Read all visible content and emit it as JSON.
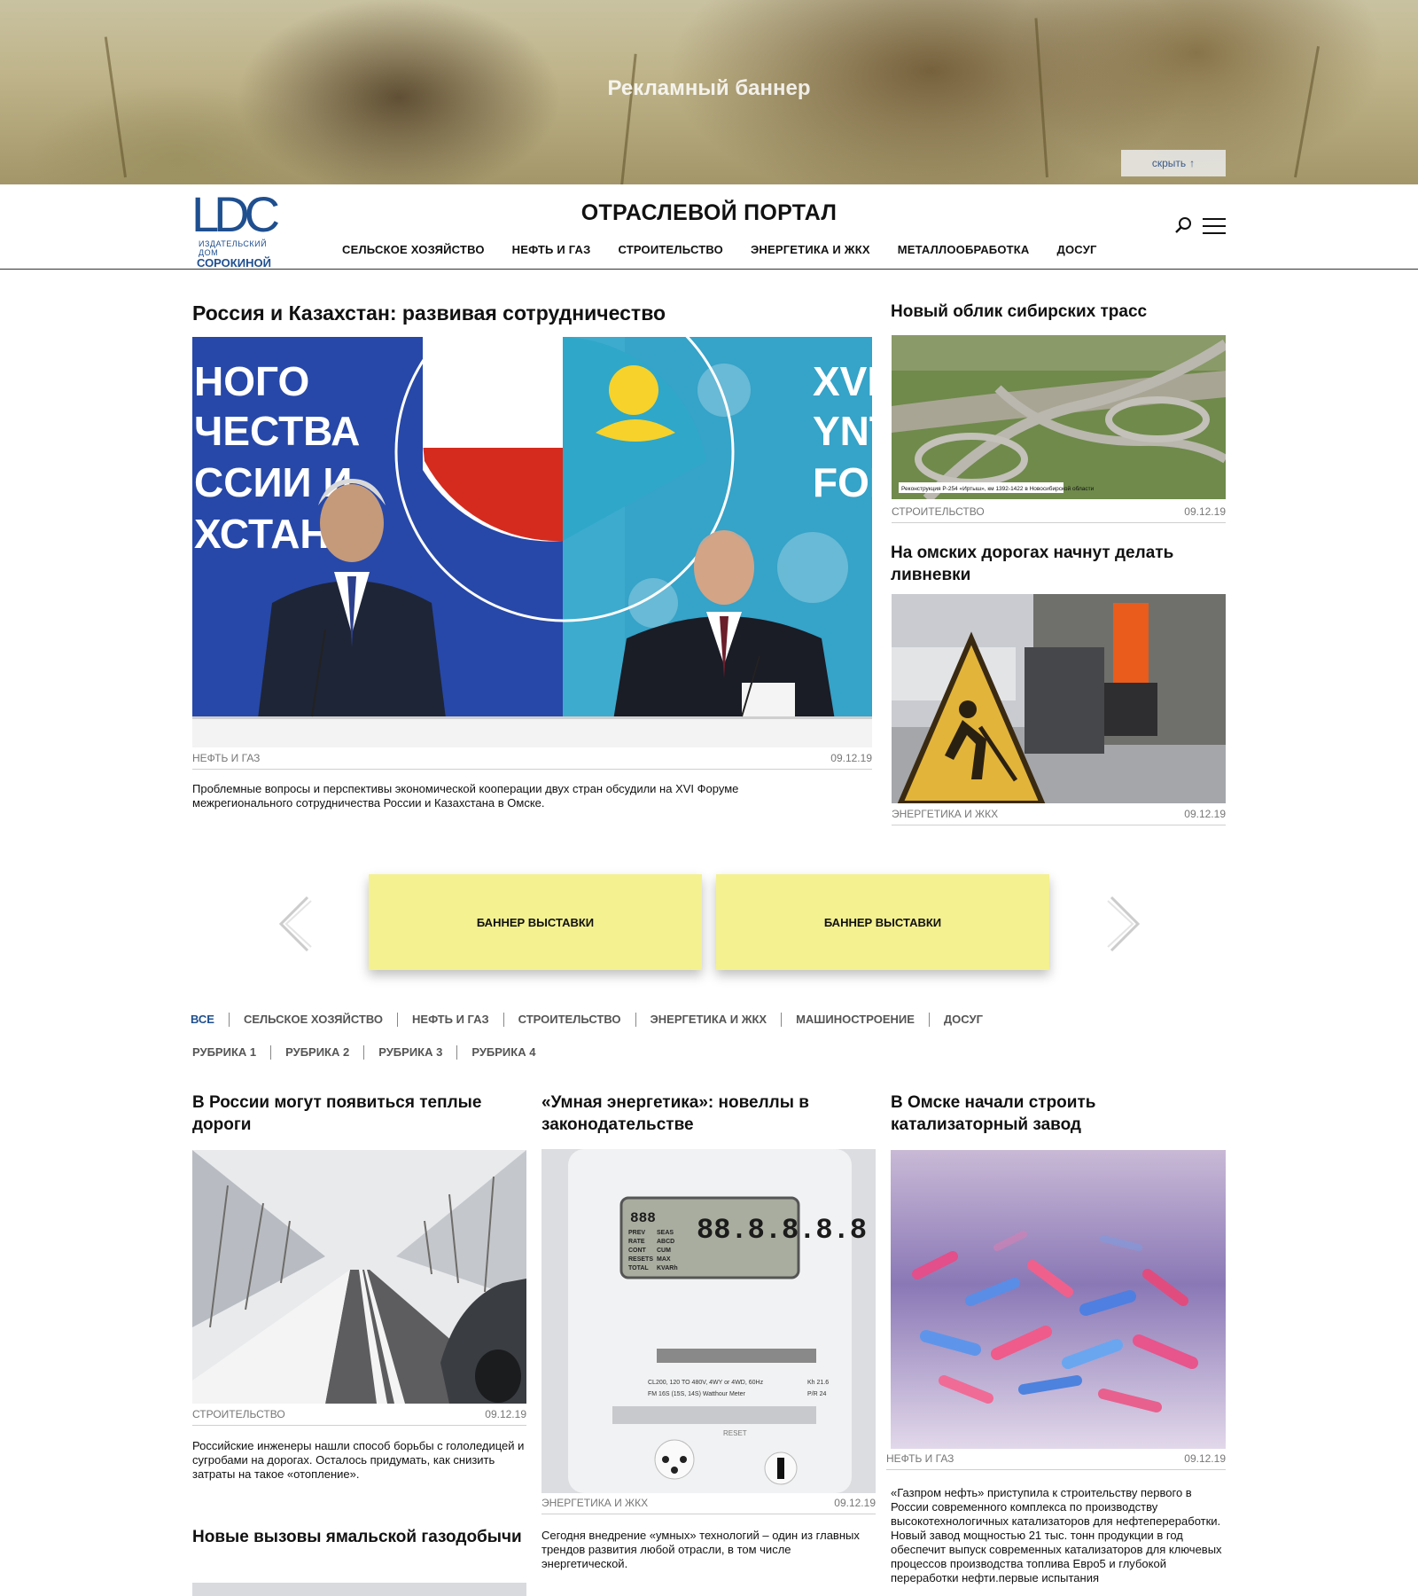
{
  "ad_banner": {
    "label": "Рекламный баннер",
    "hide_label": "скрыть",
    "hide_arrow": "↑"
  },
  "header": {
    "logo": {
      "mark": "LDC",
      "line1": "ИЗДАТЕЛЬСКИЙ ДОМ",
      "line2": "СОРОКИНОЙ"
    },
    "title": "ОТРАСЛЕВОЙ ПОРТАЛ",
    "nav": [
      "СЕЛЬСКОЕ ХОЗЯЙСТВО",
      "НЕФТЬ И ГАЗ",
      "СТРОИТЕЛЬСТВО",
      "ЭНЕРГЕТИКА И ЖКХ",
      "МЕТАЛЛООБРАБОТКА",
      "ДОСУГ"
    ]
  },
  "featured": {
    "title": "Россия и Казахстан: развивая сотрудничество",
    "category": "НЕФТЬ И ГАЗ",
    "date": "09.12.19",
    "lead": "Проблемные вопросы и перспективы экономической кооперации двух стран обсудили на XVI Форуме межрегионального сотрудничества России и Казахстана в Омске.",
    "backdrop_left": [
      "НОГО",
      "ЧЕСТВА",
      "ССИИ И",
      "ХСТАНА"
    ],
    "backdrop_right": [
      "XVI",
      "YNT",
      "FOR"
    ]
  },
  "side_articles": [
    {
      "title": "Новый облик сибирских трасс",
      "category": "СТРОИТЕЛЬСТВО",
      "date": "09.12.19",
      "caption": "Реконструкция Р-254 «Иртыш», км 1392-1422 в Новосибирской области"
    },
    {
      "title": "На омских дорогах начнут делать ливневки",
      "category": "ЭНЕРГЕТИКА И ЖКХ",
      "date": "09.12.19"
    }
  ],
  "carousel": {
    "banners": [
      "БАННЕР ВЫСТАВКИ",
      "БАННЕР ВЫСТАВКИ"
    ]
  },
  "filters": {
    "row1": [
      "ВСЕ",
      "СЕЛЬСКОЕ ХОЗЯЙСТВО",
      "НЕФТЬ И ГАЗ",
      "СТРОИТЕЛЬСТВО",
      "ЭНЕРГЕТИКА И ЖКХ",
      "МАШИНОСТРОЕНИЕ",
      "ДОСУГ"
    ],
    "row2": [
      "РУБРИКА 1",
      "РУБРИКА 2",
      "РУБРИКА 3",
      "РУБРИКА 4"
    ],
    "active": "ВСЕ"
  },
  "grid": [
    {
      "title": "В России могут появиться теплые дороги",
      "category": "СТРОИТЕЛЬСТВО",
      "date": "09.12.19",
      "lead": "Российские инженеры нашли способ борьбы с гололедицей и сугробами на дорогах. Осталось придумать, как снизить затраты на такое «отопление»."
    },
    {
      "title": "«Умная энергетика»: новеллы в законодательстве",
      "category": "ЭНЕРГЕТИКА И ЖКХ",
      "date": "09.12.19",
      "lead": "Сегодня внедрение «умных» технологий – один из главных трендов развития любой отрасли, в том числе энергетической.",
      "meter": {
        "display": "88.8.8.8.8",
        "small": "888",
        "labels": [
          "PREV",
          "RATE",
          "CONT",
          "RESETS",
          "TOTAL"
        ],
        "labels2": [
          "SEAS",
          "ABCD",
          "CUM",
          "MAX",
          "KVARh"
        ],
        "specs": [
          "CL200, 120 TO 480V, 4WY or 4WD, 60Hz",
          "FM 16S (15S, 14S) Watthour Meter"
        ],
        "kh": [
          "Kh 21.6",
          "P/R 24"
        ],
        "reset": "RESET"
      }
    },
    {
      "title": "В Омске начали строить катализаторный завод",
      "category": "НЕФТЬ И ГАЗ",
      "date": "09.12.19",
      "lead": "«Газпром нефть» приступила к строительству первого в России современного комплекса по производству высокотехнологичных катализаторов для нефтепереработки. Новый завод мощностью 21 тыс. тонн продукции в год обеспечит выпуск современных катализаторов для ключевых процессов производства топлива Евро5 и глубокой переработки нефти.первые испытания"
    },
    {
      "title": "Новые вызовы ямальской газодобычи"
    }
  ],
  "colors": {
    "brand": "#1f4f8f",
    "expo_banner": "#f4f191",
    "meta_text": "#777777"
  }
}
